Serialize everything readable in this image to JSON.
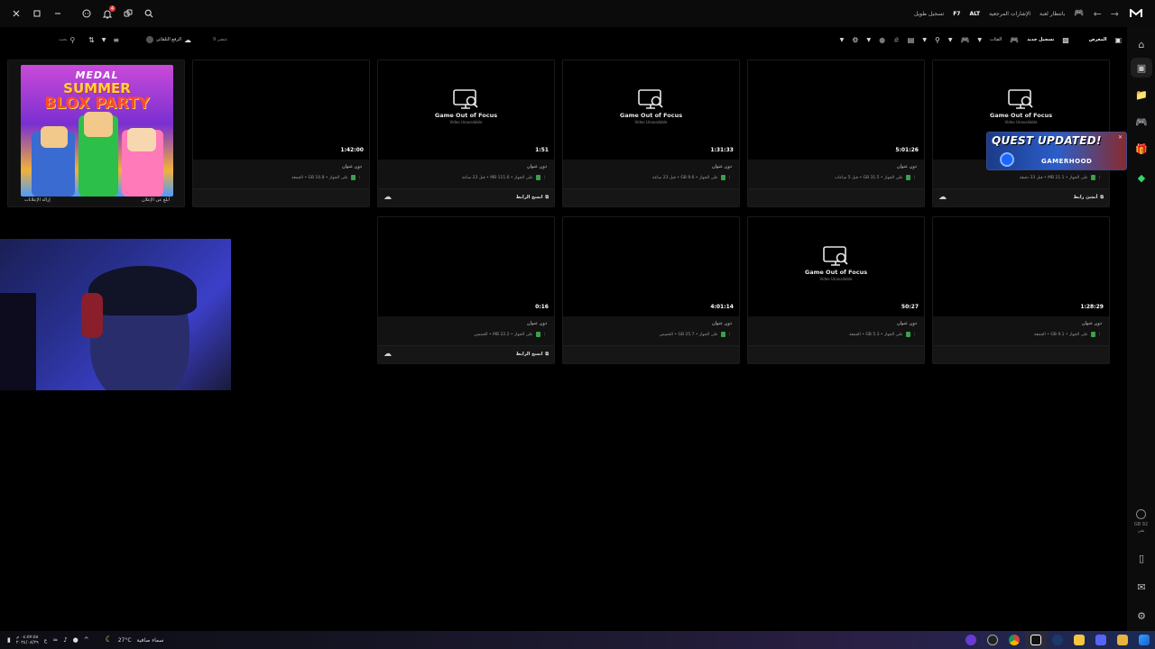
{
  "window": {
    "close_icon": "close-icon",
    "maximize_icon": "maximize-icon",
    "minimize_icon": "minimize-icon",
    "notification_count": "4"
  },
  "header": {
    "brand_icon": "medal-logo-icon",
    "hotkey_key": "F7",
    "hotkey_label": "تسجيل طويل",
    "alt_key": "ALT",
    "bookmarks_label": "الإشارات المرجعية",
    "wait_label": "بانتظار لعبة"
  },
  "toolbar": {
    "search_placeholder": "بحث",
    "count_label": "9 عنصر",
    "auto_upload_label": "الرفع التلقائي",
    "gallery_label": "المعرض",
    "new_record_label": "تسجيل جديد",
    "games_label": "الفئات"
  },
  "ad": {
    "title_line1": "MEDAL",
    "title_line2": "SUMMER",
    "title_line3": "BLOX PARTY",
    "remove_ads_label": "إزالة الإعلانات",
    "report_ad_label": "أبلغ عن الإعلان"
  },
  "clips": [
    {
      "duration": "1:42:00",
      "title": "دون عنوان",
      "meta": "على الجهاز • GB 10.8 • الجمعة",
      "unavailable": false,
      "share": "",
      "cloud": false
    },
    {
      "duration": "1:51",
      "title": "دون عنوان",
      "meta": "على الجهاز • MB 111.6 • قبل 23 ساعة",
      "unavailable": true,
      "share": "انسخ الرابط",
      "cloud": true
    },
    {
      "duration": "1:31:33",
      "title": "دون عنوان",
      "meta": "على الجهاز • GB 9.6 • قبل 23 ساعة",
      "unavailable": true,
      "share": "",
      "cloud": false
    },
    {
      "duration": "5:01:26",
      "title": "دون عنوان",
      "meta": "على الجهاز • GB 31.5 • قبل 5 ساعات",
      "unavailable": false,
      "share": "",
      "cloud": false
    },
    {
      "duration": "",
      "title": "دون عنوان",
      "meta": "على الجهاز • MB 21.1 • قبل 33 دقيقة",
      "unavailable": true,
      "share": "أنشئ رابط",
      "cloud": true
    },
    {
      "duration": "0:16",
      "title": "دون عنوان",
      "meta": "على الجهاز • MB 22.2 • الخميس",
      "unavailable": false,
      "share": "انسخ الرابط",
      "cloud": true
    },
    {
      "duration": "4:01:14",
      "title": "دون عنوان",
      "meta": "على الجهاز • GB 25.7 • الخميس",
      "unavailable": false,
      "share": "",
      "cloud": false
    },
    {
      "duration": "50:27",
      "title": "دون عنوان",
      "meta": "على الجهاز • GB 5.3 • الجمعة",
      "unavailable": true,
      "share": "",
      "cloud": false
    },
    {
      "duration": "1:28:29",
      "title": "دون عنوان",
      "meta": "على الجهاز • GB 9.1 • الجمعة",
      "unavailable": false,
      "share": "",
      "cloud": false
    }
  ],
  "game_out_of_focus": {
    "title": "Game Out of Focus",
    "subtitle": "Video Unavailable"
  },
  "quest": {
    "title": "QUEST UPDATED!",
    "subtitle": "GAMERHOOD"
  },
  "sidebar": {
    "storage_value": "GB 92",
    "storage_unit": "بقي"
  },
  "taskbar": {
    "weather_temp": "27°C",
    "weather_text": "سماء صافية",
    "clock_time": "٠٤:٥٧:٥٨ م",
    "clock_date": "٢٠٢٤/٠٨/٢٩",
    "lang": "ع"
  }
}
